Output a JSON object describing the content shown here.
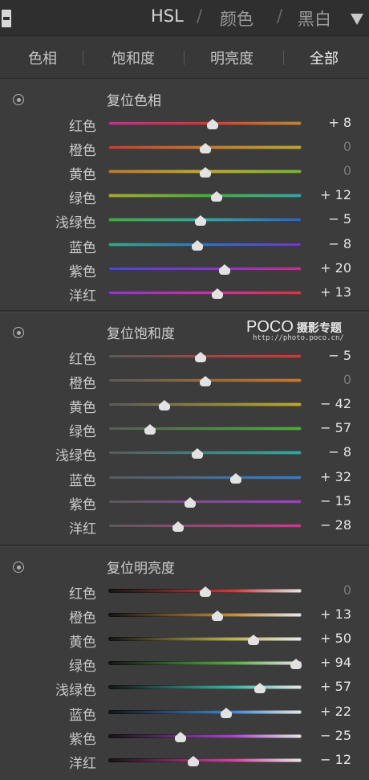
{
  "header": {
    "titles": [
      "HSL",
      "颜色",
      "黑白"
    ],
    "separators": [
      "/",
      "/"
    ]
  },
  "tabs": [
    "色相",
    "饱和度",
    "明亮度",
    "全部"
  ],
  "active_tab": "全部",
  "watermark": {
    "logo": "POCO",
    "title": "摄影专题",
    "url": "http://photo.poco.cn/"
  },
  "sections": [
    {
      "title": "复位色相",
      "rows": [
        {
          "label": "红色",
          "value": "+ 8",
          "num": 8
        },
        {
          "label": "橙色",
          "value": "0",
          "num": 0
        },
        {
          "label": "黄色",
          "value": "0",
          "num": 0
        },
        {
          "label": "绿色",
          "value": "+ 12",
          "num": 12
        },
        {
          "label": "浅绿色",
          "value": "− 5",
          "num": -5
        },
        {
          "label": "蓝色",
          "value": "− 8",
          "num": -8
        },
        {
          "label": "紫色",
          "value": "+ 20",
          "num": 20
        },
        {
          "label": "洋红",
          "value": "+ 13",
          "num": 13
        }
      ]
    },
    {
      "title": "复位饱和度",
      "rows": [
        {
          "label": "红色",
          "value": "− 5",
          "num": -5
        },
        {
          "label": "橙色",
          "value": "0",
          "num": 0
        },
        {
          "label": "黄色",
          "value": "− 42",
          "num": -42
        },
        {
          "label": "绿色",
          "value": "− 57",
          "num": -57
        },
        {
          "label": "浅绿色",
          "value": "− 8",
          "num": -8
        },
        {
          "label": "蓝色",
          "value": "+ 32",
          "num": 32
        },
        {
          "label": "紫色",
          "value": "− 15",
          "num": -15
        },
        {
          "label": "洋红",
          "value": "− 28",
          "num": -28
        }
      ]
    },
    {
      "title": "复位明亮度",
      "rows": [
        {
          "label": "红色",
          "value": "0",
          "num": 0
        },
        {
          "label": "橙色",
          "value": "+ 13",
          "num": 13
        },
        {
          "label": "黄色",
          "value": "+ 50",
          "num": 50
        },
        {
          "label": "绿色",
          "value": "+ 94",
          "num": 94
        },
        {
          "label": "浅绿色",
          "value": "+ 57",
          "num": 57
        },
        {
          "label": "蓝色",
          "value": "+ 22",
          "num": 22
        },
        {
          "label": "紫色",
          "value": "− 25",
          "num": -25
        },
        {
          "label": "洋红",
          "value": "− 12",
          "num": -12
        }
      ]
    }
  ],
  "track_colors": {
    "hue": [
      [
        "#b03a8a",
        "#c23f3f",
        "#b9893a"
      ],
      [
        "#b8443c",
        "#c27a35",
        "#b7a93a"
      ],
      [
        "#b87a34",
        "#b9ad37",
        "#7fae3a"
      ],
      [
        "#a6aa36",
        "#52a943",
        "#3aa7a0"
      ],
      [
        "#4aa64a",
        "#3ba59c",
        "#3562b4"
      ],
      [
        "#3aa589",
        "#3a6fb3",
        "#6a3fb6"
      ],
      [
        "#4e4bb8",
        "#7a3fb6",
        "#b23c86"
      ],
      [
        "#8540b5",
        "#b33c99",
        "#c13f4c"
      ]
    ],
    "saturation": [
      "#c0403f",
      "#c27a35",
      "#b9a837",
      "#52a943",
      "#3ba59c",
      "#3a7dc0",
      "#9a43b8",
      "#c23f8a"
    ],
    "luminance": [
      "#c0403f",
      "#c28c44",
      "#bcb05a",
      "#5aaa48",
      "#45b0a6",
      "#4a86c4",
      "#a04cbc",
      "#c8489a"
    ]
  }
}
